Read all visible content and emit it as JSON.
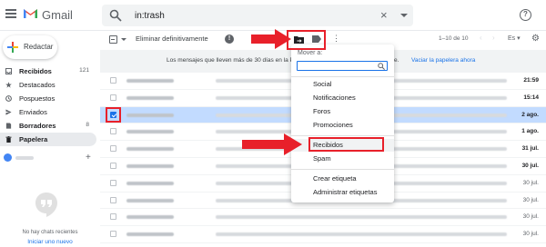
{
  "header": {
    "app_name": "Gmail",
    "search": {
      "value": "in:trash",
      "clear": "×"
    },
    "help": "?"
  },
  "sidebar": {
    "compose_label": "Redactar",
    "items": [
      {
        "label": "Recibidos",
        "count": "121",
        "icon": "inbox-icon",
        "bold": true
      },
      {
        "label": "Destacados",
        "count": "",
        "icon": "star-icon"
      },
      {
        "label": "Pospuestos",
        "count": "",
        "icon": "clock-icon"
      },
      {
        "label": "Enviados",
        "count": "",
        "icon": "send-icon"
      },
      {
        "label": "Borradores",
        "count": "8",
        "icon": "draft-icon",
        "bold": true
      },
      {
        "label": "Papelera",
        "count": "",
        "icon": "trash-icon",
        "active": true
      }
    ],
    "user_add": "+",
    "no_chats": "No hay chats recientes",
    "new_chat": "Iniciar uno nuevo"
  },
  "toolbar": {
    "delete_forever": "Eliminar definitivamente",
    "report": "!",
    "more": "⋮",
    "pagination": "1–10 de 10",
    "prev": "‹",
    "next": "›",
    "language": "Es ▾",
    "settings": "⚙"
  },
  "notice": {
    "text": "Los mensajes que lleven más de 30 días en la Papelera se eliminarán automáticamente.",
    "link": "Vaciar la papelera ahora"
  },
  "emails": [
    {
      "date": "21:59",
      "selected": false,
      "bold": true
    },
    {
      "date": "15:14",
      "selected": false,
      "bold": true
    },
    {
      "date": "2 ago.",
      "selected": true,
      "bold": true
    },
    {
      "date": "1 ago.",
      "selected": false,
      "bold": true
    },
    {
      "date": "31 jul.",
      "selected": false,
      "bold": true
    },
    {
      "date": "30 jul.",
      "selected": false,
      "bold": true
    },
    {
      "date": "30 jul.",
      "selected": false,
      "bold": false
    },
    {
      "date": "30 jul.",
      "selected": false,
      "bold": false
    },
    {
      "date": "30 jul.",
      "selected": false,
      "bold": false
    },
    {
      "date": "30 jul.",
      "selected": false,
      "bold": false
    }
  ],
  "move_menu": {
    "title": "Mover a:",
    "items": [
      "Social",
      "Notificaciones",
      "Foros",
      "Promociones",
      "Recibidos",
      "Spam",
      "Crear etiqueta",
      "Administrar etiquetas"
    ],
    "highlighted": "Recibidos"
  },
  "colors": {
    "accent": "#1a73e8",
    "annotation": "#e8202a",
    "selected_row": "#c2dbff"
  }
}
